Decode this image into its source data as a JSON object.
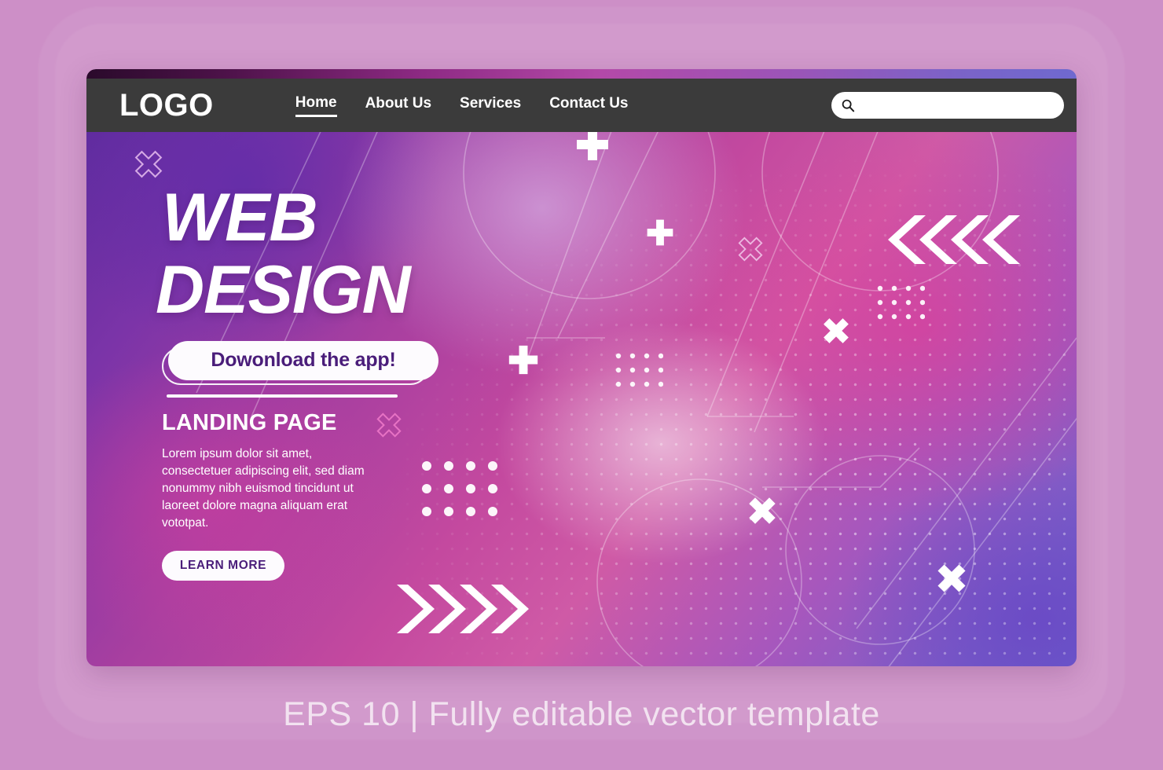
{
  "navbar": {
    "logo": "LOGO",
    "links": [
      {
        "label": "Home",
        "active": true
      },
      {
        "label": "About Us",
        "active": false
      },
      {
        "label": "Services",
        "active": false
      },
      {
        "label": "Contact Us",
        "active": false
      }
    ],
    "search": {
      "icon": "search-icon",
      "value": "",
      "placeholder": ""
    },
    "background_color": "#3b3b3b",
    "text_color": "#ffffff"
  },
  "hero": {
    "headline_line1": "WEB",
    "headline_line2": "DESIGN",
    "download_button": "Dowonload the app!",
    "subtitle": "LANDING PAGE",
    "body": "Lorem ipsum dolor sit amet, consectetuer adipiscing elit, sed diam nonummy nibh euismod tincidunt ut laoreet dolore magna aliquam erat vototpat.",
    "cta_button": "LEARN MORE",
    "accent_text_color": "#4a1d7a",
    "pill_color": "#fdfbfe"
  },
  "decor": {
    "chevrons_right_count": 4,
    "chevrons_left_count": 4,
    "plus_count": 3,
    "x_filled_count": 3,
    "x_outline_count": 3,
    "dot_grid_count": 3
  },
  "caption": "EPS 10 | Fully editable vector template",
  "colors": {
    "page_background": "#cd8fc7",
    "caption_color": "#f2e2f0",
    "gradient_purple": "#5a2a9c",
    "gradient_magenta": "#c4499f",
    "gradient_indigo": "#6a5fcc"
  }
}
